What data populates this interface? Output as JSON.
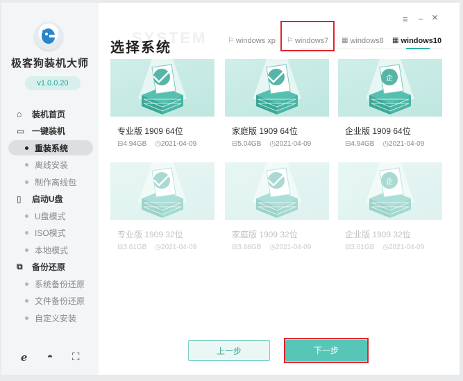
{
  "app": {
    "title": "极客狗装机大师",
    "version": "v1.0.0.20"
  },
  "window_controls": {
    "menu": "≡",
    "minimize": "−",
    "close": "×"
  },
  "sidebar": {
    "groups": [
      {
        "label": "装机首页",
        "icon": "home-icon"
      },
      {
        "label": "一键装机",
        "icon": "monitor-icon"
      },
      {
        "label": "启动U盘",
        "icon": "usb-icon"
      },
      {
        "label": "备份还原",
        "icon": "backup-icon"
      }
    ],
    "items": [
      {
        "label": "重装系统"
      },
      {
        "label": "离线安装"
      },
      {
        "label": "制作离线包"
      },
      {
        "label": "U盘模式"
      },
      {
        "label": "ISO模式"
      },
      {
        "label": "本地模式"
      },
      {
        "label": "系统备份还原"
      },
      {
        "label": "文件备份还原"
      },
      {
        "label": "自定义安装"
      }
    ],
    "bottom_icons": [
      "ie-icon",
      "network-icon",
      "tools-icon"
    ]
  },
  "page": {
    "heading": "选择系统",
    "heading_watermark": "SYSTEM"
  },
  "tabs": [
    {
      "label": "windows xp",
      "icon": "windows-old-icon"
    },
    {
      "label": "windows7",
      "icon": "windows-old-icon"
    },
    {
      "label": "windows8",
      "icon": "windows-new-icon"
    },
    {
      "label": "windows10",
      "icon": "windows-new-icon",
      "active": true
    }
  ],
  "systems": [
    {
      "name": "专业版 1909 64位",
      "size": "4.94GB",
      "date": "2021-04-09",
      "badge": "check"
    },
    {
      "name": "家庭版 1909 64位",
      "size": "5.04GB",
      "date": "2021-04-09",
      "badge": "check"
    },
    {
      "name": "企业版 1909 64位",
      "size": "4.94GB",
      "date": "2021-04-09",
      "badge": "企"
    },
    {
      "name": "专业版 1909 32位",
      "size": "3.61GB",
      "date": "2021-04-09",
      "badge": "check"
    },
    {
      "name": "家庭版 1909 32位",
      "size": "3.68GB",
      "date": "2021-04-09",
      "badge": "check"
    },
    {
      "name": "企业版 1909 32位",
      "size": "3.61GB",
      "date": "2021-04-09",
      "badge": "企"
    }
  ],
  "buttons": {
    "prev": "上一步",
    "next": "下一步"
  },
  "colors": {
    "accent": "#58c6b7",
    "highlight": "#e0242c"
  }
}
